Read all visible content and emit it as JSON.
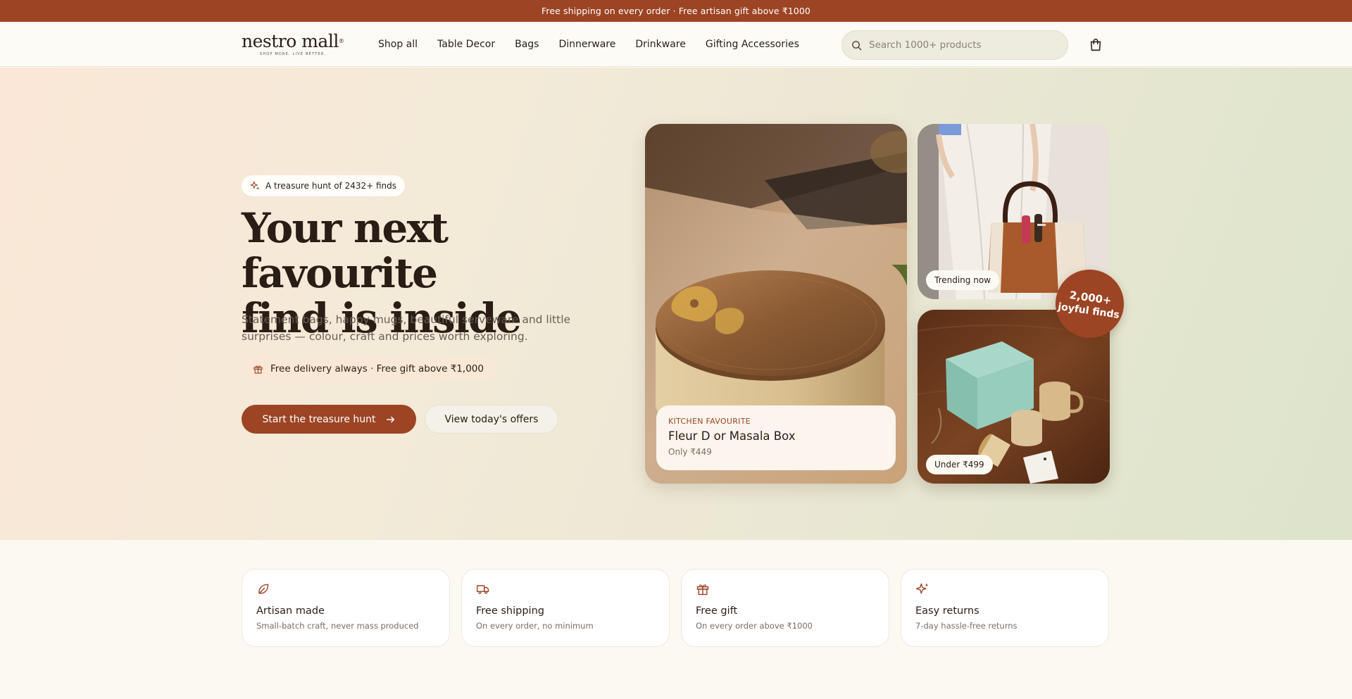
{
  "promo": {
    "text": "Free shipping on every order · Free artisan gift above ₹1000"
  },
  "header": {
    "logo": {
      "name": "nestro mall",
      "tagline": "SHOP MORE. LIVE BETTER."
    },
    "nav": [
      "Shop all",
      "Table Decor",
      "Bags",
      "Dinnerware",
      "Drinkware",
      "Gifting Accessories"
    ],
    "search": {
      "placeholder": "Search 1000+ products",
      "icon": "search-icon"
    },
    "cart": {
      "icon": "shopping-bag-icon"
    }
  },
  "hero": {
    "badge": "A treasure hunt of 2432+ finds",
    "title_line1": "Your next favourite",
    "title_line2": "find is inside",
    "subtitle": "Statement bags, happy mugs, beautiful serveware and little surprises — colour, craft and prices worth exploring.",
    "delivery": "Free delivery always · Free gift above ₹1,000",
    "primary_cta": "Start the treasure hunt",
    "secondary_cta": "View today's offers"
  },
  "showcase": {
    "featured": {
      "kicker": "KITCHEN FAVOURITE",
      "name": "Fleur D or Masala Box",
      "price": "Only ₹449"
    },
    "top_right_tag": "Trending now",
    "bottom_right_tag": "Under ₹499",
    "badge_line1": "2,000+",
    "badge_line2": "joyful finds"
  },
  "features": [
    {
      "icon": "leaf-icon",
      "title": "Artisan made",
      "desc": "Small-batch craft, never mass produced"
    },
    {
      "icon": "truck-icon",
      "title": "Free shipping",
      "desc": "On every order, no minimum"
    },
    {
      "icon": "gift-icon",
      "title": "Free gift",
      "desc": "On every order above ₹1000"
    },
    {
      "icon": "sparkle-icon",
      "title": "Easy returns",
      "desc": "7-day hassle-free returns"
    }
  ],
  "colors": {
    "accent": "#9c4424",
    "ink": "#2a1d15",
    "cream": "#fcf9f2"
  }
}
